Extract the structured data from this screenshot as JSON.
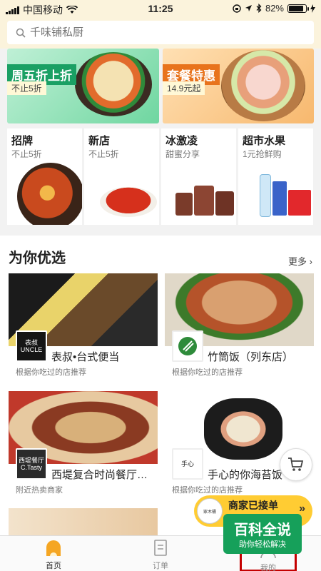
{
  "status_bar": {
    "carrier": "中国移动",
    "time": "11:25",
    "battery": "82%"
  },
  "search": {
    "placeholder": "千味铺私厨",
    "icon": "search-icon"
  },
  "banners": [
    {
      "title": "周五折上折",
      "subtitle": "不止5折"
    },
    {
      "title": "套餐特惠",
      "subtitle": "14.9元起"
    }
  ],
  "categories": [
    {
      "name": "招牌",
      "desc": "不止5折"
    },
    {
      "name": "新店",
      "desc": "不止5折"
    },
    {
      "name": "冰激凌",
      "desc": "甜蜜分享"
    },
    {
      "name": "超市水果",
      "desc": "1元抢鲜购"
    }
  ],
  "section": {
    "title": "为你优选",
    "more": "更多 ›"
  },
  "shops": [
    {
      "name": "表叔•台式便当",
      "reason": "根据你吃过的店推荐",
      "logo_text": "表叔 UNCLE"
    },
    {
      "name": "竹筒饭（列东店）",
      "reason": "根据你吃过的店推荐",
      "logo_text": ""
    },
    {
      "name": "西堤复合时尚餐厅…",
      "reason": "附近热卖商家",
      "logo_text": "西堤餐厅 C.Tasty"
    },
    {
      "name": "手心的你海苔饭",
      "reason": "根据你吃过的店推荐",
      "logo_text": "手心"
    }
  ],
  "order_toast": {
    "message": "商家已接单",
    "shop_logo_text": "家木桶"
  },
  "tabs": [
    {
      "label": "首页"
    },
    {
      "label": "订单"
    },
    {
      "label": "我的"
    }
  ],
  "watermark": {
    "title": "百科全说",
    "subtitle": "助你轻松解决"
  },
  "colors": {
    "brand": "#ffcc33",
    "active_tab": "#f5a623",
    "watermark": "#16a05a",
    "highlight_box": "#c40000"
  }
}
